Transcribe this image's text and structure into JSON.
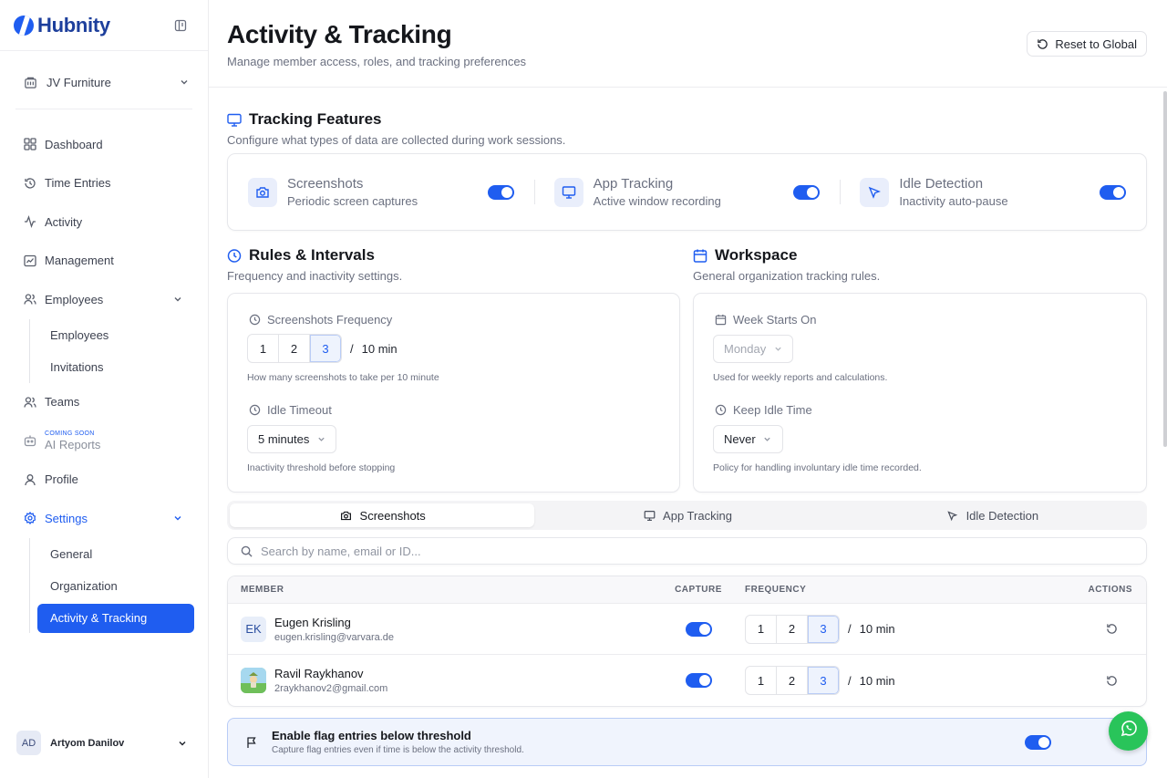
{
  "app": {
    "name": "Hubnity"
  },
  "sidebar": {
    "org": "JV Furniture",
    "items": [
      {
        "label": "Dashboard"
      },
      {
        "label": "Time Entries"
      },
      {
        "label": "Activity"
      },
      {
        "label": "Management"
      },
      {
        "label": "Employees"
      },
      {
        "label": "Teams"
      },
      {
        "label": "AI Reports",
        "badge": "COMING SOON"
      },
      {
        "label": "Profile"
      },
      {
        "label": "Settings"
      }
    ],
    "employees_sub": [
      "Employees",
      "Invitations"
    ],
    "settings_sub": [
      "General",
      "Organization",
      "Activity & Tracking"
    ],
    "user": {
      "initials": "AD",
      "name": "Artyom Danilov"
    }
  },
  "header": {
    "title": "Activity & Tracking",
    "subtitle": "Manage member access, roles, and tracking preferences",
    "reset_label": "Reset to Global"
  },
  "tracking": {
    "title": "Tracking Features",
    "subtitle": "Configure what types of data are collected during work sessions.",
    "features": [
      {
        "title": "Screenshots",
        "desc": "Periodic screen captures",
        "icon": "camera-icon",
        "enabled": true
      },
      {
        "title": "App Tracking",
        "desc": "Active window recording",
        "icon": "monitor-icon",
        "enabled": true
      },
      {
        "title": "Idle Detection",
        "desc": "Inactivity auto-pause",
        "icon": "cursor-icon",
        "enabled": true
      }
    ]
  },
  "rules": {
    "title": "Rules & Intervals",
    "subtitle": "Frequency and inactivity settings.",
    "freq_label": "Screenshots Frequency",
    "freq_options": [
      "1",
      "2",
      "3"
    ],
    "freq_selected": "3",
    "freq_suffix": "/",
    "freq_unit": "10 min",
    "freq_help": "How many screenshots to take per 10 minute",
    "idle_label": "Idle Timeout",
    "idle_value": "5 minutes",
    "idle_help": "Inactivity threshold before stopping"
  },
  "workspace": {
    "title": "Workspace",
    "subtitle": "General organization tracking rules.",
    "week_label": "Week Starts On",
    "week_value": "Monday",
    "week_help": "Used for weekly reports and calculations.",
    "keep_label": "Keep Idle Time",
    "keep_value": "Never",
    "keep_help": "Policy for handling involuntary idle time recorded."
  },
  "tabs": [
    "Screenshots",
    "App Tracking",
    "Idle Detection"
  ],
  "search": {
    "placeholder": "Search by name, email or ID..."
  },
  "table": {
    "headers": {
      "member": "MEMBER",
      "capture": "CAPTURE",
      "frequency": "FREQUENCY",
      "actions": "ACTIONS"
    },
    "rows": [
      {
        "initials": "EK",
        "name": "Eugen Krisling",
        "email": "eugen.krisling@varvara.de",
        "capture": true,
        "freq": [
          "1",
          "2",
          "3"
        ],
        "selected": "3",
        "unit": "10 min"
      },
      {
        "initials": "",
        "name": "Ravil Raykhanov",
        "email": "2raykhanov2@gmail.com",
        "capture": true,
        "freq": [
          "1",
          "2",
          "3"
        ],
        "selected": "3",
        "unit": "10 min"
      }
    ]
  },
  "flag": {
    "title": "Enable flag entries below threshold",
    "desc": "Capture flag entries even if time is below the activity threshold.",
    "enabled": true
  },
  "colors": {
    "accent": "#1f5df0",
    "whatsapp": "#29c45a"
  }
}
